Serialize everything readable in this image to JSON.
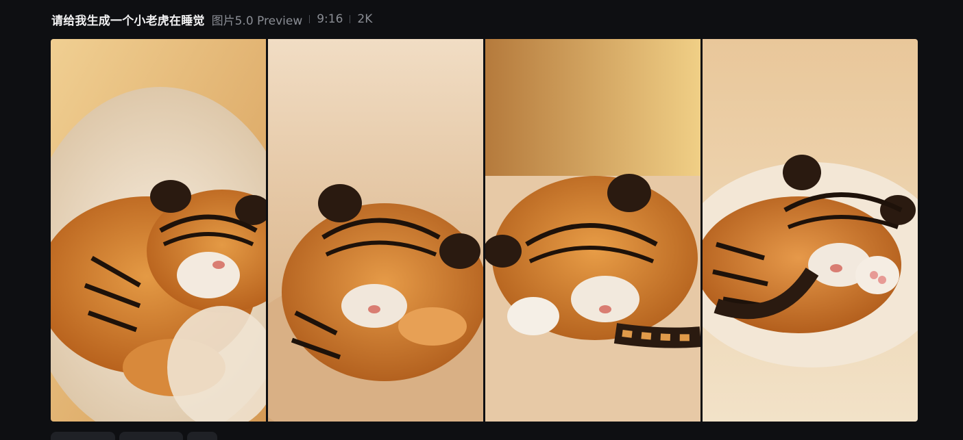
{
  "header": {
    "prompt": "请给我生成一个小老虎在睡觉",
    "model": "图片5.0 Preview",
    "ratio": "9:16",
    "resolution": "2K"
  },
  "gallery": {
    "images": [
      {
        "alt": "sleeping tiger cub in fluffy bed",
        "bg": "#e8c79a"
      },
      {
        "alt": "sleeping tiger cub on blanket",
        "bg": "#eed8bb"
      },
      {
        "alt": "sleeping tiger cub curled on blanket",
        "bg": "#e2b873"
      },
      {
        "alt": "sleeping tiger cub with tail",
        "bg": "#e9cfab"
      }
    ]
  },
  "actions": [
    {
      "label": ""
    },
    {
      "label": ""
    },
    {
      "label": ""
    }
  ]
}
